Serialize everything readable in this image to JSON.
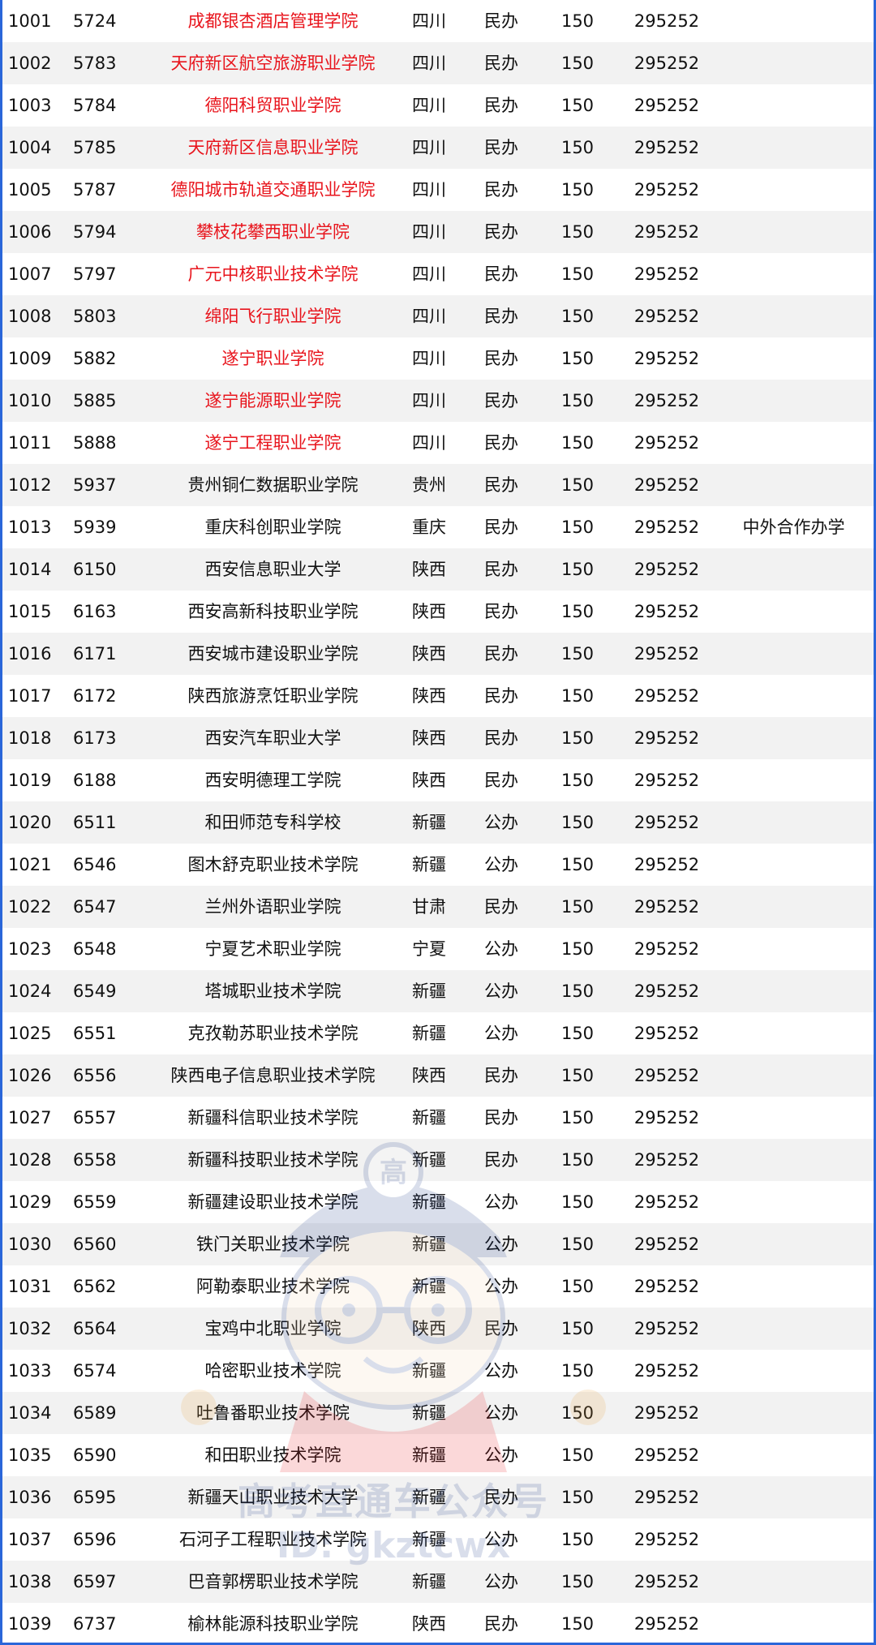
{
  "colors": {
    "frame": "#2a66d9",
    "highlight": "#e8141c",
    "stripe": "#f2f2f2"
  },
  "rows": [
    {
      "seq": "1001",
      "code": "5724",
      "name": "成都银杏酒店管理学院",
      "province": "四川",
      "type": "民办",
      "score": "150",
      "rank": "295252",
      "note": "",
      "highlight": true
    },
    {
      "seq": "1002",
      "code": "5783",
      "name": "天府新区航空旅游职业学院",
      "province": "四川",
      "type": "民办",
      "score": "150",
      "rank": "295252",
      "note": "",
      "highlight": true
    },
    {
      "seq": "1003",
      "code": "5784",
      "name": "德阳科贸职业学院",
      "province": "四川",
      "type": "民办",
      "score": "150",
      "rank": "295252",
      "note": "",
      "highlight": true
    },
    {
      "seq": "1004",
      "code": "5785",
      "name": "天府新区信息职业学院",
      "province": "四川",
      "type": "民办",
      "score": "150",
      "rank": "295252",
      "note": "",
      "highlight": true
    },
    {
      "seq": "1005",
      "code": "5787",
      "name": "德阳城市轨道交通职业学院",
      "province": "四川",
      "type": "民办",
      "score": "150",
      "rank": "295252",
      "note": "",
      "highlight": true
    },
    {
      "seq": "1006",
      "code": "5794",
      "name": "攀枝花攀西职业学院",
      "province": "四川",
      "type": "民办",
      "score": "150",
      "rank": "295252",
      "note": "",
      "highlight": true
    },
    {
      "seq": "1007",
      "code": "5797",
      "name": "广元中核职业技术学院",
      "province": "四川",
      "type": "民办",
      "score": "150",
      "rank": "295252",
      "note": "",
      "highlight": true
    },
    {
      "seq": "1008",
      "code": "5803",
      "name": "绵阳飞行职业学院",
      "province": "四川",
      "type": "民办",
      "score": "150",
      "rank": "295252",
      "note": "",
      "highlight": true
    },
    {
      "seq": "1009",
      "code": "5882",
      "name": "遂宁职业学院",
      "province": "四川",
      "type": "民办",
      "score": "150",
      "rank": "295252",
      "note": "",
      "highlight": true
    },
    {
      "seq": "1010",
      "code": "5885",
      "name": "遂宁能源职业学院",
      "province": "四川",
      "type": "民办",
      "score": "150",
      "rank": "295252",
      "note": "",
      "highlight": true
    },
    {
      "seq": "1011",
      "code": "5888",
      "name": "遂宁工程职业学院",
      "province": "四川",
      "type": "民办",
      "score": "150",
      "rank": "295252",
      "note": "",
      "highlight": true
    },
    {
      "seq": "1012",
      "code": "5937",
      "name": "贵州铜仁数据职业学院",
      "province": "贵州",
      "type": "民办",
      "score": "150",
      "rank": "295252",
      "note": "",
      "highlight": false
    },
    {
      "seq": "1013",
      "code": "5939",
      "name": "重庆科创职业学院",
      "province": "重庆",
      "type": "民办",
      "score": "150",
      "rank": "295252",
      "note": "中外合作办学",
      "highlight": false
    },
    {
      "seq": "1014",
      "code": "6150",
      "name": "西安信息职业大学",
      "province": "陕西",
      "type": "民办",
      "score": "150",
      "rank": "295252",
      "note": "",
      "highlight": false
    },
    {
      "seq": "1015",
      "code": "6163",
      "name": "西安高新科技职业学院",
      "province": "陕西",
      "type": "民办",
      "score": "150",
      "rank": "295252",
      "note": "",
      "highlight": false
    },
    {
      "seq": "1016",
      "code": "6171",
      "name": "西安城市建设职业学院",
      "province": "陕西",
      "type": "民办",
      "score": "150",
      "rank": "295252",
      "note": "",
      "highlight": false
    },
    {
      "seq": "1017",
      "code": "6172",
      "name": "陕西旅游烹饪职业学院",
      "province": "陕西",
      "type": "民办",
      "score": "150",
      "rank": "295252",
      "note": "",
      "highlight": false
    },
    {
      "seq": "1018",
      "code": "6173",
      "name": "西安汽车职业大学",
      "province": "陕西",
      "type": "民办",
      "score": "150",
      "rank": "295252",
      "note": "",
      "highlight": false
    },
    {
      "seq": "1019",
      "code": "6188",
      "name": "西安明德理工学院",
      "province": "陕西",
      "type": "民办",
      "score": "150",
      "rank": "295252",
      "note": "",
      "highlight": false
    },
    {
      "seq": "1020",
      "code": "6511",
      "name": "和田师范专科学校",
      "province": "新疆",
      "type": "公办",
      "score": "150",
      "rank": "295252",
      "note": "",
      "highlight": false
    },
    {
      "seq": "1021",
      "code": "6546",
      "name": "图木舒克职业技术学院",
      "province": "新疆",
      "type": "公办",
      "score": "150",
      "rank": "295252",
      "note": "",
      "highlight": false
    },
    {
      "seq": "1022",
      "code": "6547",
      "name": "兰州外语职业学院",
      "province": "甘肃",
      "type": "民办",
      "score": "150",
      "rank": "295252",
      "note": "",
      "highlight": false
    },
    {
      "seq": "1023",
      "code": "6548",
      "name": "宁夏艺术职业学院",
      "province": "宁夏",
      "type": "公办",
      "score": "150",
      "rank": "295252",
      "note": "",
      "highlight": false
    },
    {
      "seq": "1024",
      "code": "6549",
      "name": "塔城职业技术学院",
      "province": "新疆",
      "type": "公办",
      "score": "150",
      "rank": "295252",
      "note": "",
      "highlight": false
    },
    {
      "seq": "1025",
      "code": "6551",
      "name": "克孜勒苏职业技术学院",
      "province": "新疆",
      "type": "公办",
      "score": "150",
      "rank": "295252",
      "note": "",
      "highlight": false
    },
    {
      "seq": "1026",
      "code": "6556",
      "name": "陕西电子信息职业技术学院",
      "province": "陕西",
      "type": "民办",
      "score": "150",
      "rank": "295252",
      "note": "",
      "highlight": false
    },
    {
      "seq": "1027",
      "code": "6557",
      "name": "新疆科信职业技术学院",
      "province": "新疆",
      "type": "民办",
      "score": "150",
      "rank": "295252",
      "note": "",
      "highlight": false
    },
    {
      "seq": "1028",
      "code": "6558",
      "name": "新疆科技职业技术学院",
      "province": "新疆",
      "type": "民办",
      "score": "150",
      "rank": "295252",
      "note": "",
      "highlight": false
    },
    {
      "seq": "1029",
      "code": "6559",
      "name": "新疆建设职业技术学院",
      "province": "新疆",
      "type": "公办",
      "score": "150",
      "rank": "295252",
      "note": "",
      "highlight": false
    },
    {
      "seq": "1030",
      "code": "6560",
      "name": "铁门关职业技术学院",
      "province": "新疆",
      "type": "公办",
      "score": "150",
      "rank": "295252",
      "note": "",
      "highlight": false
    },
    {
      "seq": "1031",
      "code": "6562",
      "name": "阿勒泰职业技术学院",
      "province": "新疆",
      "type": "公办",
      "score": "150",
      "rank": "295252",
      "note": "",
      "highlight": false
    },
    {
      "seq": "1032",
      "code": "6564",
      "name": "宝鸡中北职业学院",
      "province": "陕西",
      "type": "民办",
      "score": "150",
      "rank": "295252",
      "note": "",
      "highlight": false
    },
    {
      "seq": "1033",
      "code": "6574",
      "name": "哈密职业技术学院",
      "province": "新疆",
      "type": "公办",
      "score": "150",
      "rank": "295252",
      "note": "",
      "highlight": false
    },
    {
      "seq": "1034",
      "code": "6589",
      "name": "吐鲁番职业技术学院",
      "province": "新疆",
      "type": "公办",
      "score": "150",
      "rank": "295252",
      "note": "",
      "highlight": false
    },
    {
      "seq": "1035",
      "code": "6590",
      "name": "和田职业技术学院",
      "province": "新疆",
      "type": "公办",
      "score": "150",
      "rank": "295252",
      "note": "",
      "highlight": false
    },
    {
      "seq": "1036",
      "code": "6595",
      "name": "新疆天山职业技术大学",
      "province": "新疆",
      "type": "民办",
      "score": "150",
      "rank": "295252",
      "note": "",
      "highlight": false
    },
    {
      "seq": "1037",
      "code": "6596",
      "name": "石河子工程职业技术学院",
      "province": "新疆",
      "type": "公办",
      "score": "150",
      "rank": "295252",
      "note": "",
      "highlight": false
    },
    {
      "seq": "1038",
      "code": "6597",
      "name": "巴音郭楞职业技术学院",
      "province": "新疆",
      "type": "公办",
      "score": "150",
      "rank": "295252",
      "note": "",
      "highlight": false
    },
    {
      "seq": "1039",
      "code": "6737",
      "name": "榆林能源科技职业学院",
      "province": "陕西",
      "type": "民办",
      "score": "150",
      "rank": "295252",
      "note": "",
      "highlight": false
    }
  ],
  "watermark": {
    "icon": "cartoon-mascot-logo",
    "badge_char": "高",
    "title": "高考直通车公众号",
    "id_text": "ID: gkztcwx"
  }
}
